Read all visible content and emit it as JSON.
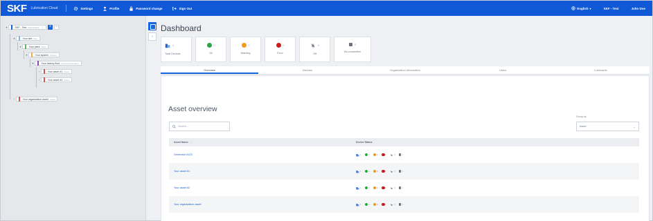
{
  "topbar": {
    "brand": "SKF",
    "app_name": "Lubrication Cloud",
    "nav": [
      {
        "label": "Settings",
        "icon": "gear-icon"
      },
      {
        "label": "Profile",
        "icon": "user-icon"
      },
      {
        "label": "Password change",
        "icon": "lock-icon"
      },
      {
        "label": "Sign Out",
        "icon": "sign-out-icon"
      }
    ],
    "language": "English",
    "org": "SKF - Test",
    "user": "John Doe"
  },
  "tree": [
    {
      "label": "SKF - Test",
      "type": "Organization"
    },
    {
      "label": "Your site",
      "type": "Site"
    },
    {
      "label": "Your plant",
      "type": "Plant"
    },
    {
      "label": "Your system",
      "type": "System"
    },
    {
      "label": "Your factory floor",
      "type": "Functional location"
    },
    {
      "label": "Your asset #1",
      "type": "Asset"
    },
    {
      "label": "Your asset #2",
      "type": "Asset"
    },
    {
      "label": "Your organization asset",
      "type": "Asset"
    }
  ],
  "dashboard": {
    "title": "Dashboard",
    "cards": [
      {
        "label": "Total Devices",
        "count": "4",
        "kind": "devices"
      },
      {
        "label": "Ok",
        "count": "0",
        "kind": "ok"
      },
      {
        "label": "Warning",
        "count": "0",
        "kind": "warning"
      },
      {
        "label": "Error",
        "count": "0",
        "kind": "error"
      },
      {
        "label": "Off",
        "count": "0",
        "kind": "off"
      },
      {
        "label": "No connection",
        "count": "0",
        "kind": "noconn"
      }
    ],
    "tabs": [
      "Overview",
      "Devices",
      "Organization Information",
      "Users",
      "Lubricants"
    ],
    "active_tab": "Overview"
  },
  "overview": {
    "title": "Asset overview",
    "search_placeholder": "Search...",
    "group_by_label": "Group by",
    "group_by_value": "Asset",
    "columns": [
      "Asset Name",
      "Device Status"
    ],
    "rows": [
      {
        "name": "Generator #123",
        "counts": [
          "1",
          "0",
          "0",
          "0",
          "0",
          "0"
        ]
      },
      {
        "name": "Your asset #1",
        "counts": [
          "1",
          "0",
          "0",
          "0",
          "0",
          "0"
        ]
      },
      {
        "name": "Your asset #2",
        "counts": [
          "1",
          "0",
          "0",
          "0",
          "0",
          "0"
        ]
      },
      {
        "name": "Your organization asset",
        "counts": [
          "1",
          "0",
          "0",
          "0",
          "0",
          "0"
        ]
      }
    ]
  },
  "colors": {
    "brand_blue": "#0f58d6",
    "ok": "#28a745",
    "warning": "#f39c12",
    "error": "#c81e1e"
  }
}
